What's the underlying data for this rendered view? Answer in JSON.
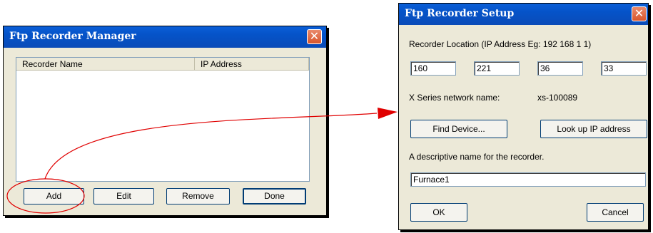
{
  "manager": {
    "title": "Ftp Recorder Manager",
    "columns": [
      "Recorder Name",
      "IP Address"
    ],
    "rows": [],
    "buttons": {
      "add": "Add",
      "edit": "Edit",
      "remove": "Remove",
      "done": "Done"
    },
    "close_icon": "close-icon"
  },
  "setup": {
    "title": "Ftp Recorder Setup",
    "location_label": "Recorder Location (IP Address Eg: 192 168 1 1)",
    "ip": [
      "160",
      "221",
      "36",
      "33"
    ],
    "network_name_label": "X Series network name:",
    "network_name_value": "xs-100089",
    "find_device": "Find Device...",
    "lookup_ip": "Look up IP address",
    "description_label": "A descriptive name for the recorder.",
    "description_value": "Furnace1",
    "ok": "OK",
    "cancel": "Cancel"
  },
  "colors": {
    "titlebar": "#0553c8",
    "dialog_bg": "#ece9d8",
    "annotation": "#e00000"
  }
}
